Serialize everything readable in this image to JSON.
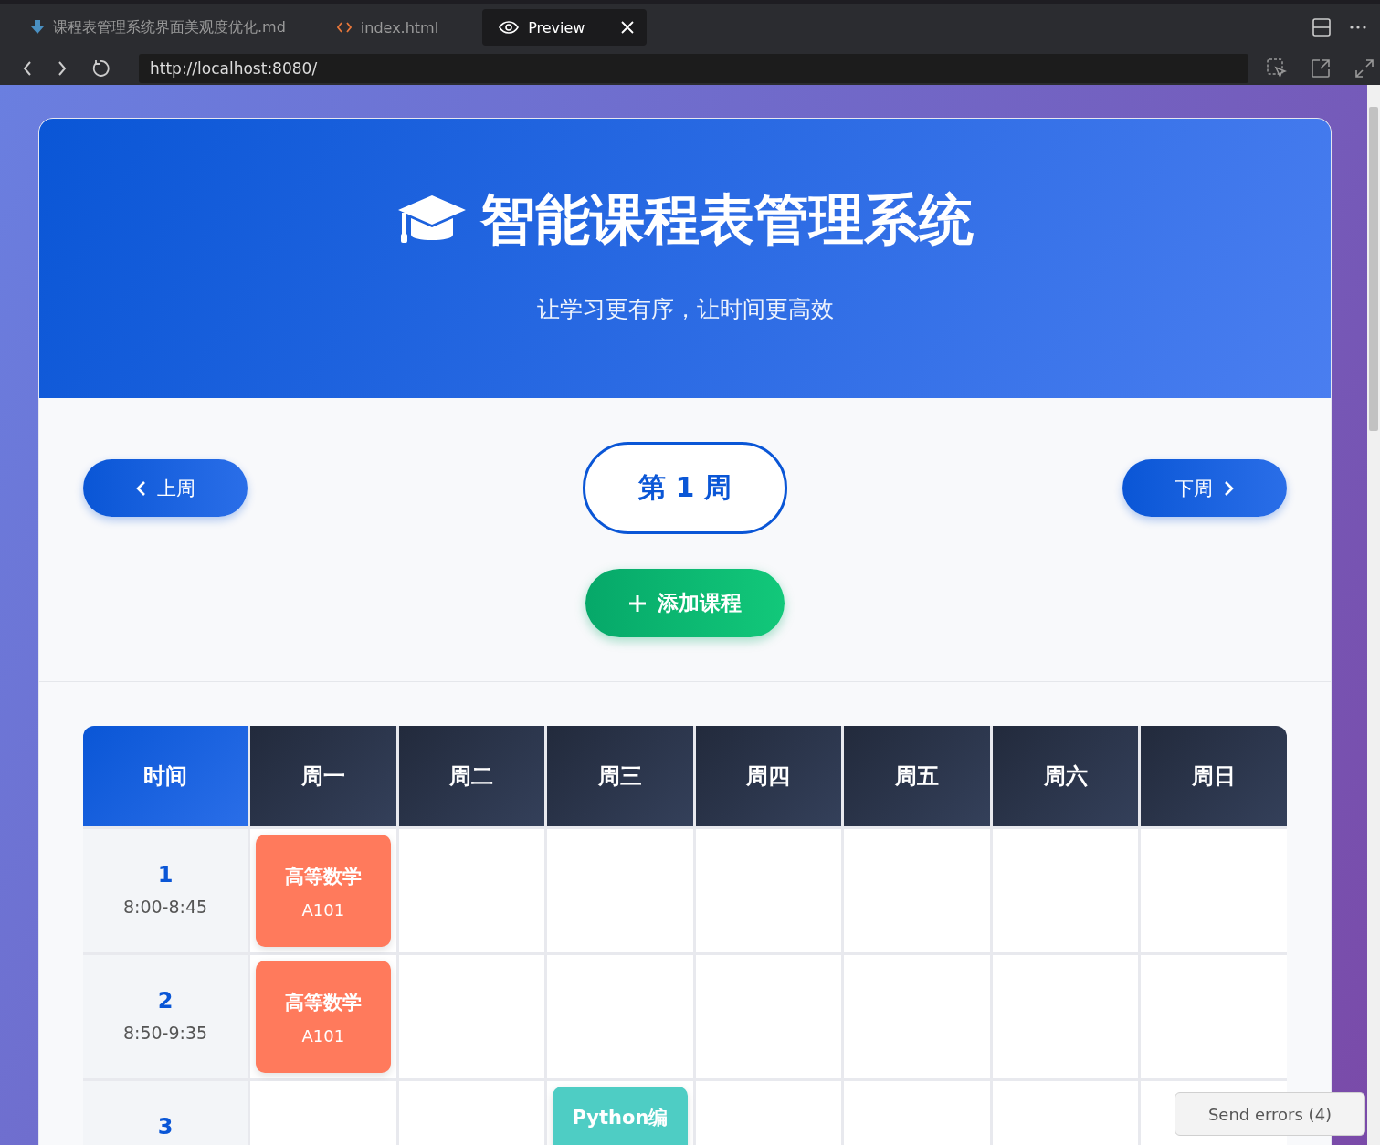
{
  "tabs": [
    {
      "kind": "markdown",
      "label": "课程表管理系统界面美观度优化.md",
      "selected": false
    },
    {
      "kind": "code",
      "label": "index.html",
      "selected": false
    },
    {
      "kind": "preview",
      "label": "Preview",
      "selected": true
    }
  ],
  "url": "http://localhost:8080/",
  "header": {
    "title": "智能课程表管理系统",
    "subtitle": "让学习更有序，让时间更高效"
  },
  "week_nav": {
    "prev": "上周",
    "current": "第 1 周",
    "next": "下周"
  },
  "add_button": "添加课程",
  "table": {
    "columns": [
      {
        "label": "时间",
        "kind": "time"
      },
      {
        "label": "周一",
        "kind": "day"
      },
      {
        "label": "周二",
        "kind": "day"
      },
      {
        "label": "周三",
        "kind": "day"
      },
      {
        "label": "周四",
        "kind": "day"
      },
      {
        "label": "周五",
        "kind": "day"
      },
      {
        "label": "周六",
        "kind": "day"
      },
      {
        "label": "周日",
        "kind": "day"
      }
    ],
    "rows": [
      {
        "cells": [
          {
            "kind": "time",
            "period": "1",
            "time": "8:00-8:45"
          },
          {
            "kind": "course",
            "name": "高等数学",
            "room": "A101",
            "color": "#ff7a5c"
          },
          "",
          "",
          "",
          "",
          "",
          ""
        ]
      },
      {
        "cells": [
          {
            "kind": "time",
            "period": "2",
            "time": "8:50-9:35"
          },
          {
            "kind": "course",
            "name": "高等数学",
            "room": "A101",
            "color": "#ff7a5c"
          },
          "",
          "",
          "",
          "",
          "",
          ""
        ]
      },
      {
        "cells": [
          {
            "kind": "time",
            "period": "3"
          },
          "",
          "",
          {
            "kind": "course",
            "name": "Python编",
            "color": "#4ecdc4"
          },
          "",
          "",
          "",
          ""
        ]
      }
    ]
  },
  "send_errors": "Send errors (4)"
}
